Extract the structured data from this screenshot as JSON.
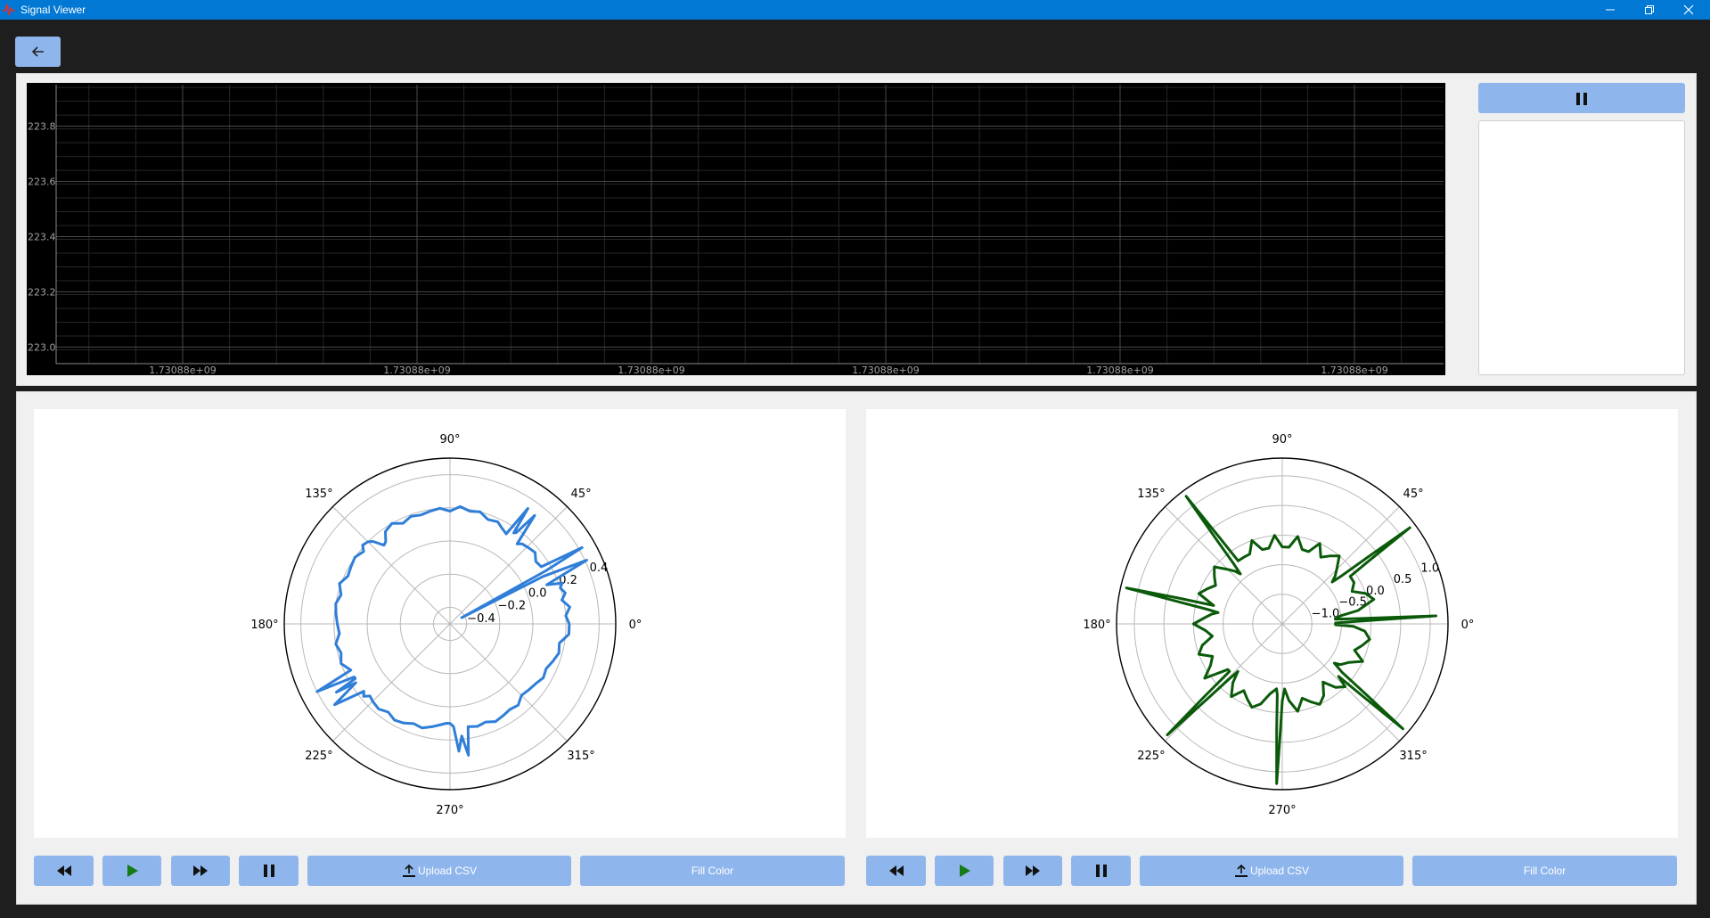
{
  "window": {
    "title": "Signal Viewer"
  },
  "signal_viewer": {
    "chart_data": {
      "type": "line",
      "series": [],
      "x_tick_labels": [
        "1.73088e+09",
        "1.73088e+09",
        "1.73088e+09",
        "1.73088e+09",
        "1.73088e+09",
        "1.73088e+09"
      ],
      "y_ticks": [
        223.0,
        223.2,
        223.4,
        223.6,
        223.8
      ],
      "y_tick_labels": [
        "223.0",
        "223.2",
        "223.4",
        "223.6",
        "223.8"
      ],
      "ylim": [
        222.94,
        223.95
      ],
      "grid": true,
      "background": "#000000"
    }
  },
  "polar_plots": [
    {
      "chart_data": {
        "type": "line",
        "coordinate_system": "polar",
        "angle_labels": [
          "0°",
          "45°",
          "90°",
          "135°",
          "180°",
          "225°",
          "270°",
          "315°"
        ],
        "r_ticks": [
          -0.4,
          -0.2,
          0.0,
          0.2,
          0.4
        ],
        "r_tick_labels": [
          "−0.4",
          "−0.2",
          "0.0",
          "0.2",
          "0.4"
        ],
        "r_range": [
          -0.5,
          0.5
        ],
        "series": [
          {
            "color": "#2f7ed8",
            "theta_deg": [
              0,
              4,
              8,
              12,
              15,
              18,
              20,
              22,
              25,
              27,
              28,
              29,
              30,
              32,
              36,
              40,
              44,
              48,
              50,
              52,
              54,
              55,
              56,
              58,
              62,
              65,
              70,
              75,
              80,
              85,
              90,
              95,
              100,
              105,
              110,
              115,
              120,
              125,
              128,
              130,
              133,
              135,
              138,
              140,
              145,
              150,
              155,
              160,
              165,
              170,
              175,
              180,
              185,
              190,
              195,
              200,
              205,
              207,
              209,
              210,
              211,
              212,
              215,
              218,
              220,
              222,
              225,
              230,
              235,
              240,
              245,
              250,
              255,
              260,
              265,
              268,
              270,
              272,
              274,
              276,
              278,
              280,
              285,
              290,
              295,
              300,
              305,
              310,
              315,
              320,
              325,
              330,
              335,
              340,
              345,
              350,
              355,
              360
            ],
            "r": [
              0.22,
              0.2,
              0.23,
              0.19,
              0.22,
              0.2,
              0.22,
              0.13,
              0.41,
              0.13,
              -0.42,
              0.16,
              0.42,
              0.15,
              0.14,
              0.17,
              0.16,
              0.15,
              0.13,
              0.33,
              0.18,
              0.17,
              0.34,
              0.14,
              0.16,
              0.18,
              0.17,
              0.2,
              0.19,
              0.21,
              0.18,
              0.2,
              0.19,
              0.18,
              0.19,
              0.17,
              0.2,
              0.18,
              0.13,
              0.12,
              0.18,
              0.2,
              0.21,
              0.18,
              0.2,
              0.19,
              0.18,
              0.21,
              0.18,
              0.2,
              0.19,
              0.18,
              0.17,
              0.2,
              0.18,
              0.2,
              0.16,
              0.4,
              0.16,
              0.16,
              0.3,
              0.17,
              0.35,
              0.16,
              0.18,
              0.15,
              0.16,
              0.17,
              0.15,
              0.17,
              0.16,
              0.14,
              0.15,
              0.13,
              0.11,
              0.1,
              0.1,
              0.12,
              0.27,
              0.18,
              0.3,
              0.13,
              0.14,
              0.13,
              0.15,
              0.14,
              0.13,
              0.14,
              0.11,
              0.12,
              0.13,
              0.15,
              0.14,
              0.16,
              0.18,
              0.17,
              0.22,
              0.22
            ]
          }
        ]
      },
      "controls": {
        "upload_label": "Upload CSV",
        "fill_label": "Fill Color"
      }
    },
    {
      "chart_data": {
        "type": "line",
        "coordinate_system": "polar",
        "angle_labels": [
          "0°",
          "45°",
          "90°",
          "135°",
          "180°",
          "225°",
          "270°",
          "315°"
        ],
        "r_ticks": [
          -1.0,
          -0.5,
          0.0,
          0.5,
          1.0
        ],
        "r_tick_labels": [
          "−1.0",
          "−0.5",
          "0.0",
          "0.5",
          "1.0"
        ],
        "r_range": [
          -1.5,
          1.3
        ],
        "series": [
          {
            "color": "#0a5a0a",
            "theta_deg": [
              0,
              1,
              2,
              3,
              4,
              5,
              6,
              8,
              10,
              15,
              20,
              25,
              30,
              35,
              36,
              37,
              38,
              39,
              40,
              42,
              45,
              50,
              55,
              60,
              65,
              70,
              75,
              80,
              85,
              90,
              95,
              100,
              105,
              110,
              115,
              120,
              125,
              126,
              127,
              128,
              129,
              130,
              132,
              135,
              140,
              145,
              150,
              155,
              160,
              165,
              166,
              167,
              168,
              169,
              170,
              172,
              175,
              180,
              185,
              190,
              195,
              200,
              205,
              210,
              215,
              220,
              222,
              223,
              224,
              225,
              226,
              227,
              230,
              235,
              240,
              245,
              250,
              255,
              260,
              265,
              266,
              267,
              268,
              269,
              270,
              272,
              275,
              280,
              285,
              290,
              295,
              300,
              305,
              310,
              315,
              317,
              318,
              319,
              320,
              321,
              323,
              325,
              330,
              335,
              340,
              345,
              350,
              355,
              358,
              359,
              360
            ],
            "r": [
              -0.6,
              -0.6,
              -0.2,
              1.1,
              -0.2,
              -0.6,
              -0.6,
              -0.5,
              -0.2,
              0.1,
              0.0,
              -0.2,
              -0.1,
              -0.1,
              0.3,
              1.2,
              0.3,
              -0.2,
              -0.4,
              -0.3,
              -0.2,
              0.0,
              -0.1,
              -0.2,
              0.0,
              -0.2,
              -0.2,
              0.0,
              -0.2,
              -0.2,
              0.0,
              -0.2,
              -0.2,
              0.0,
              -0.2,
              -0.2,
              -0.2,
              0.3,
              1.2,
              0.3,
              -0.2,
              -0.4,
              -0.3,
              -0.2,
              0.0,
              -0.1,
              -0.2,
              -0.1,
              0.0,
              -0.3,
              0.3,
              1.2,
              0.3,
              -0.2,
              -0.4,
              -0.3,
              -0.2,
              0.0,
              -0.2,
              -0.3,
              -0.1,
              0.0,
              -0.2,
              -0.1,
              0.1,
              -0.3,
              -0.3,
              0.3,
              1.2,
              0.3,
              -0.2,
              -0.4,
              -0.2,
              0.0,
              -0.2,
              -0.1,
              0.0,
              -0.1,
              -0.3,
              -0.4,
              -0.3,
              0.3,
              1.2,
              0.3,
              -0.2,
              -0.4,
              -0.2,
              0.0,
              -0.2,
              -0.1,
              0.0,
              -0.1,
              -0.3,
              -0.1,
              0.0,
              -0.2,
              0.3,
              1.2,
              0.3,
              -0.2,
              -0.4,
              -0.3,
              -0.2,
              0.0,
              -0.2,
              -0.1,
              0.0,
              -0.1,
              -0.3,
              -0.6,
              -0.6
            ]
          }
        ]
      },
      "controls": {
        "upload_label": "Upload CSV",
        "fill_label": "Fill Color"
      }
    }
  ]
}
